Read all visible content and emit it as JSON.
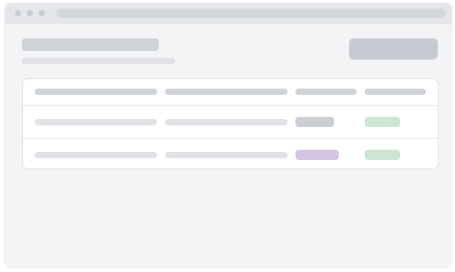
{
  "colors": {
    "window_bg": "#f3f4f6",
    "titlebar_bg": "#e4e6ea",
    "skeleton_dark": "#cfd2d7",
    "skeleton_light": "#e0e2e6",
    "button_bg": "#c7cad0",
    "card_bg": "#ffffff",
    "badge_gray": "#cbced3",
    "badge_purple": "#d6c4e4",
    "badge_green": "#cde6d2"
  },
  "window": {
    "controls": [
      "close-dot",
      "minimize-dot",
      "maximize-dot"
    ]
  },
  "table": {
    "columns": 4,
    "rows": [
      {
        "status_badge": "gray",
        "tag_badge": "green"
      },
      {
        "status_badge": "purple",
        "tag_badge": "green"
      }
    ]
  }
}
